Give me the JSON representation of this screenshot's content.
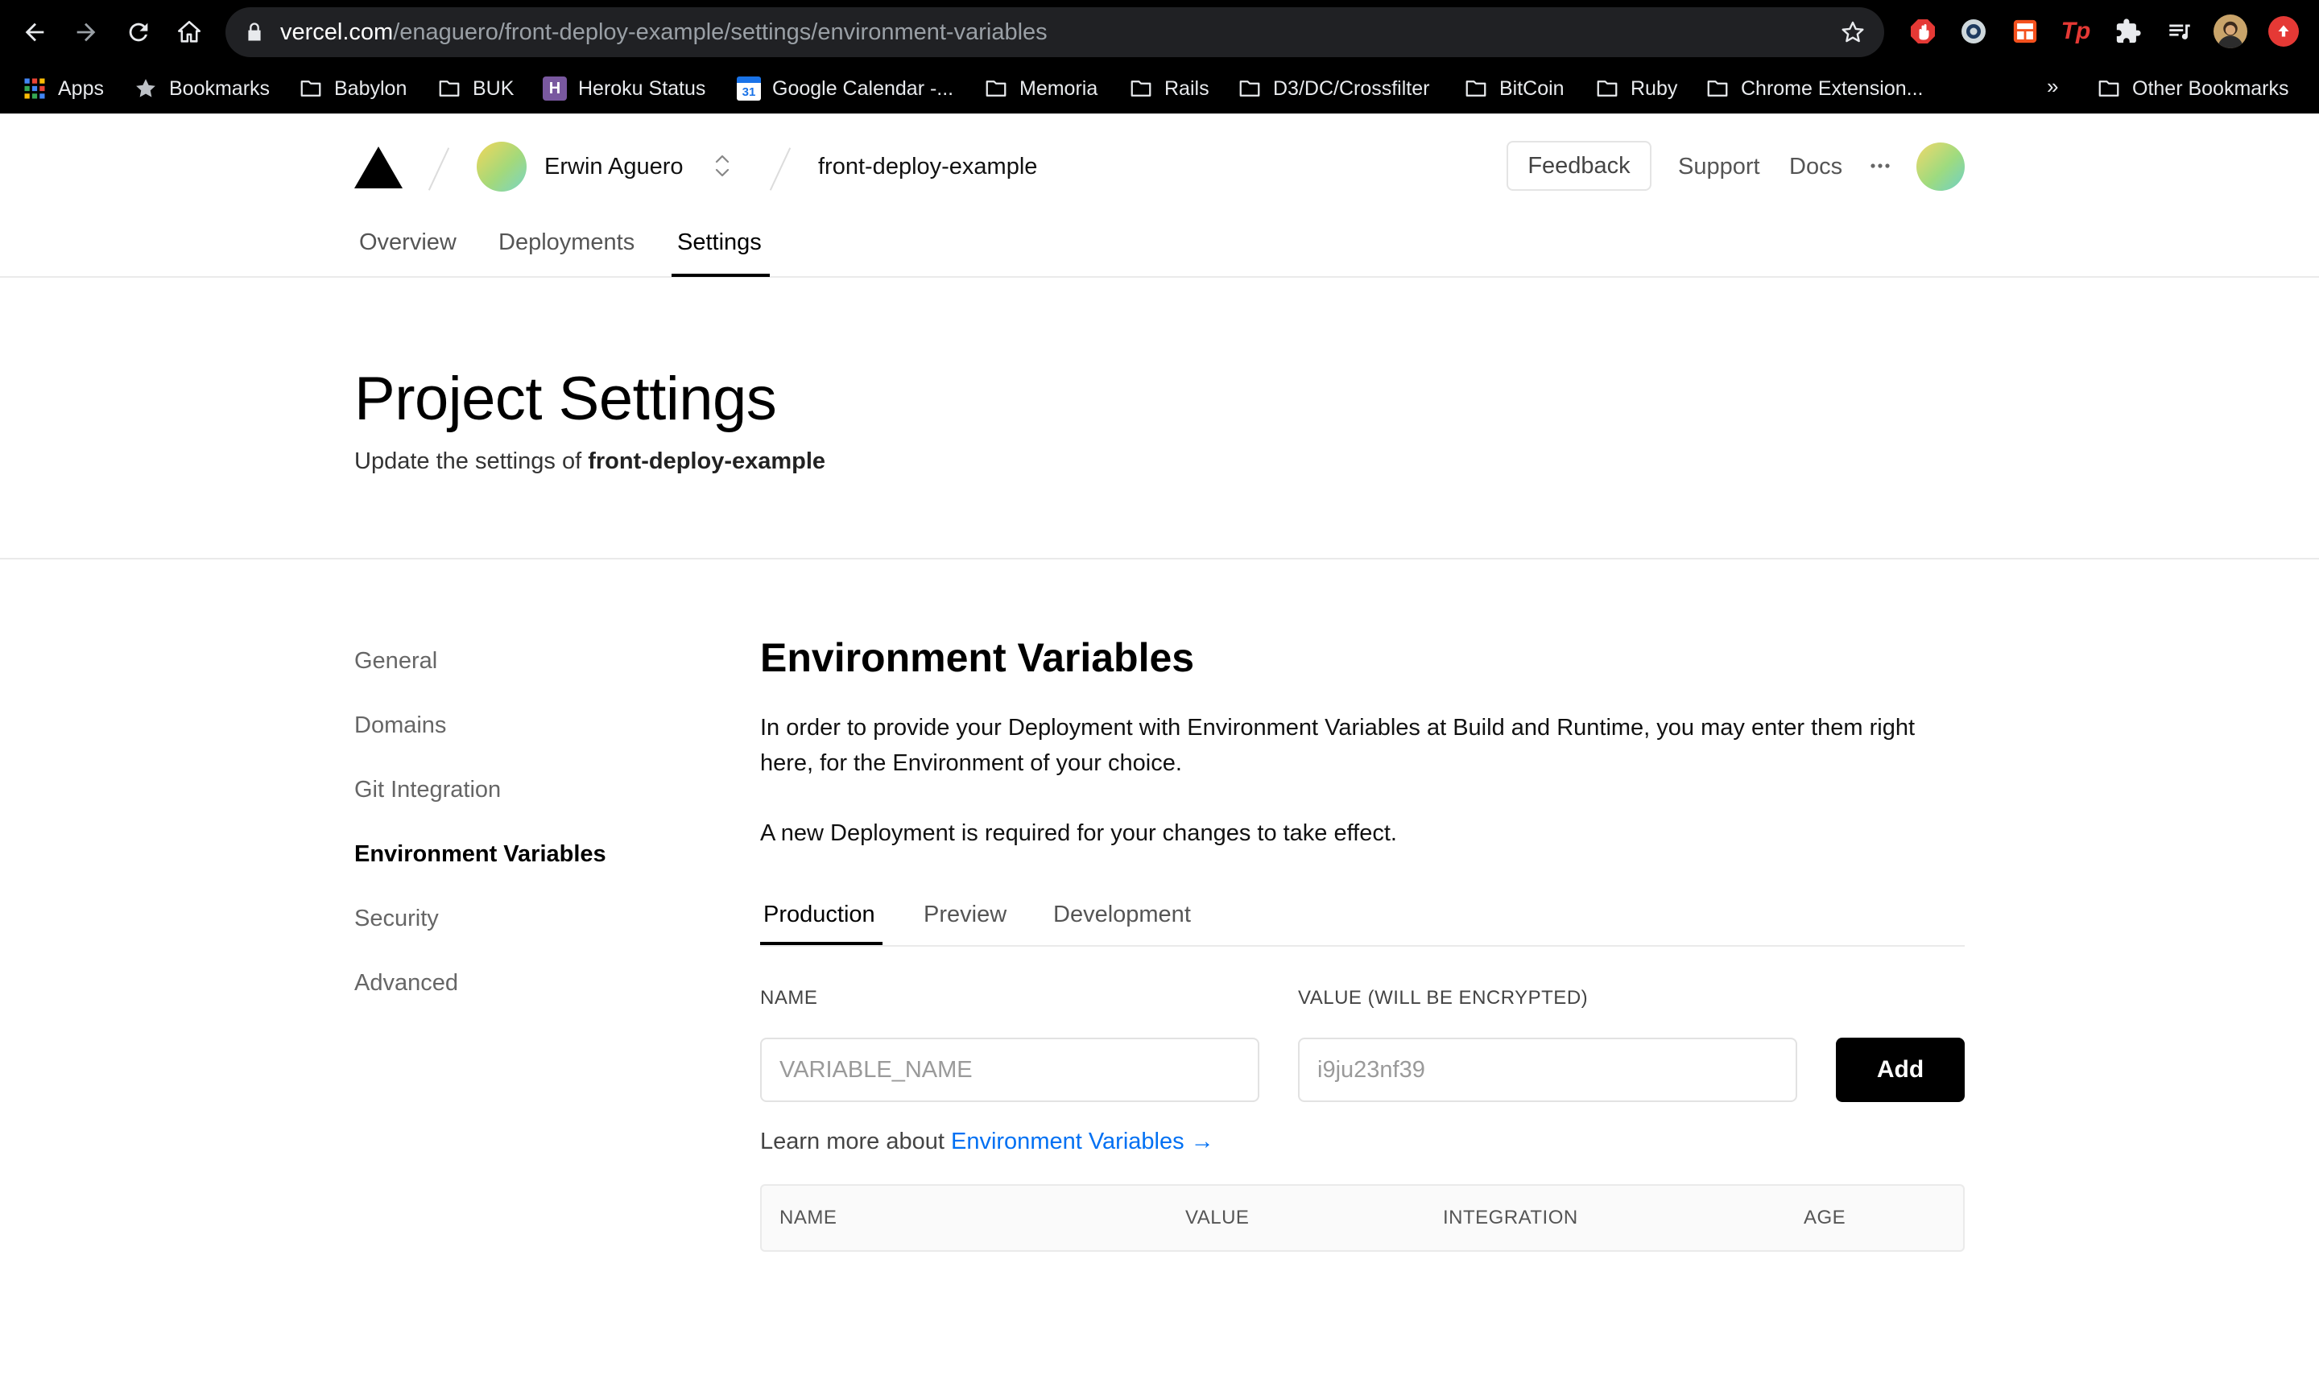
{
  "browser": {
    "url_host": "vercel.com",
    "url_path": "/enaguero/front-deploy-example/settings/environment-variables",
    "bookmarks": [
      {
        "label": "Apps",
        "icon": "apps-grid-icon"
      },
      {
        "label": "Bookmarks",
        "icon": "star-icon"
      },
      {
        "label": "Babylon",
        "icon": "folder-icon"
      },
      {
        "label": "BUK",
        "icon": "folder-icon"
      },
      {
        "label": "Heroku Status",
        "icon": "heroku-icon"
      },
      {
        "label": "Google Calendar -...",
        "icon": "calendar-icon"
      },
      {
        "label": "Memoria",
        "icon": "folder-icon"
      },
      {
        "label": "Rails",
        "icon": "folder-icon"
      },
      {
        "label": "D3/DC/Crossfilter",
        "icon": "folder-icon"
      },
      {
        "label": "BitCoin",
        "icon": "folder-icon"
      },
      {
        "label": "Ruby",
        "icon": "folder-icon"
      },
      {
        "label": "Chrome Extension...",
        "icon": "folder-icon"
      }
    ],
    "overflow": "»",
    "other_bookmarks": "Other Bookmarks",
    "calendar_day": "31",
    "heroku_letter": "H",
    "ext_tp": "Tp"
  },
  "header": {
    "team_name": "Erwin Aguero",
    "project_name": "front-deploy-example",
    "feedback": "Feedback",
    "support": "Support",
    "docs": "Docs",
    "tabs": [
      "Overview",
      "Deployments",
      "Settings"
    ],
    "active_tab": "Settings"
  },
  "hero": {
    "title": "Project Settings",
    "subtitle_prefix": "Update the settings of ",
    "subtitle_project": "front-deploy-example"
  },
  "sidebar": {
    "items": [
      "General",
      "Domains",
      "Git Integration",
      "Environment Variables",
      "Security",
      "Advanced"
    ],
    "active": "Environment Variables"
  },
  "env": {
    "title": "Environment Variables",
    "description": "In order to provide your Deployment with Environment Variables at Build and Runtime, you may enter them right here, for the Environment of your choice.",
    "notice": "A new Deployment is required for your changes to take effect.",
    "tabs": [
      "Production",
      "Preview",
      "Development"
    ],
    "active_tab": "Production",
    "name_label": "NAME",
    "value_label": "VALUE (WILL BE ENCRYPTED)",
    "name_placeholder": "VARIABLE_NAME",
    "value_placeholder": "i9ju23nf39",
    "add_label": "Add",
    "learn_prefix": "Learn more about ",
    "learn_link": "Environment Variables →",
    "table_columns": [
      "NAME",
      "VALUE",
      "INTEGRATION",
      "AGE"
    ]
  },
  "colors": {
    "link": "#0070f3",
    "primary_button": "#000000",
    "browser_chrome": "#000000",
    "omnibox": "#202124"
  }
}
